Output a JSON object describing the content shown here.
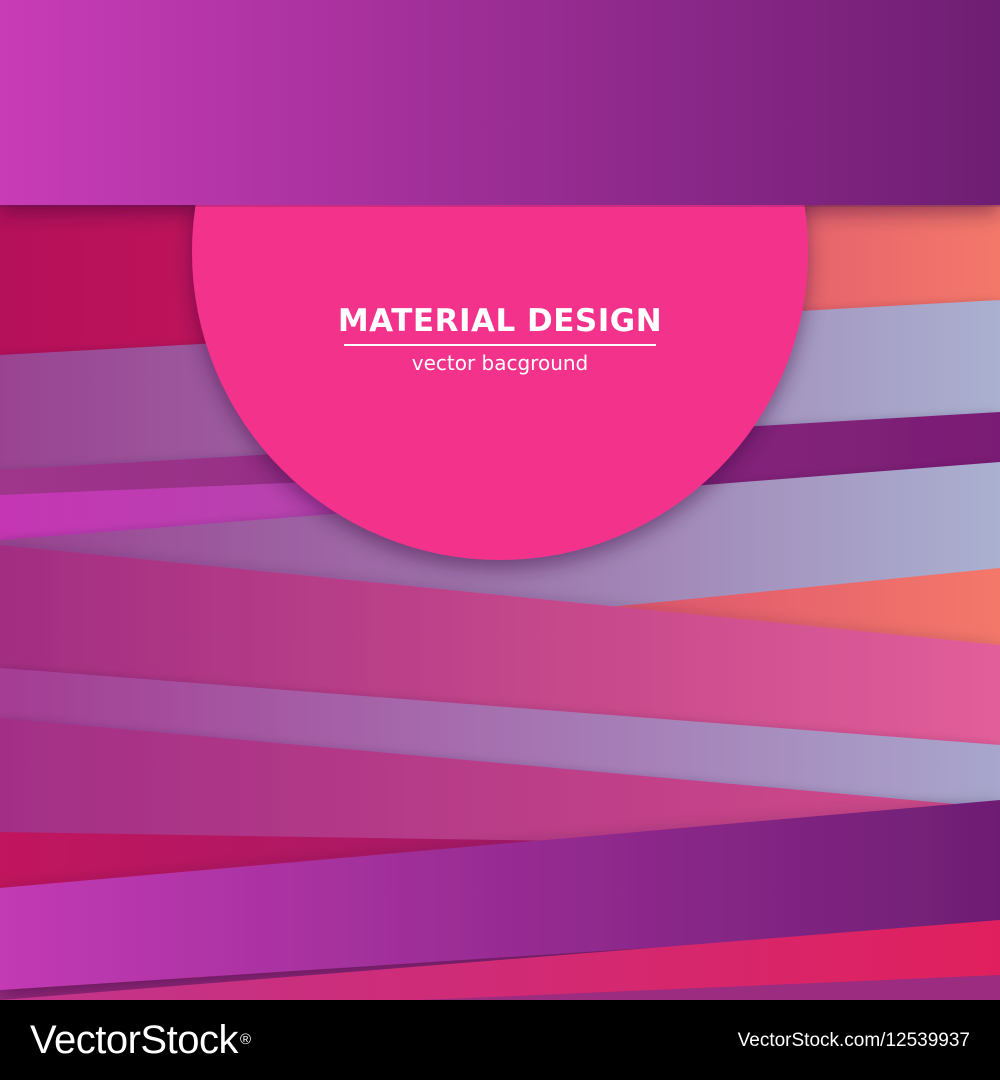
{
  "headline": {
    "title": "MATERIAL DESIGN",
    "subtitle": "vector bacground"
  },
  "watermark": {
    "brand": "VectorStock",
    "brand_mark": "®",
    "credit": "VectorStock.com/12539937"
  },
  "colors": {
    "circle": "#f2318b",
    "top_band_start": "#c83cb6",
    "top_band_end": "#6e1e73",
    "footer": "#000000",
    "text": "#ffffff"
  }
}
